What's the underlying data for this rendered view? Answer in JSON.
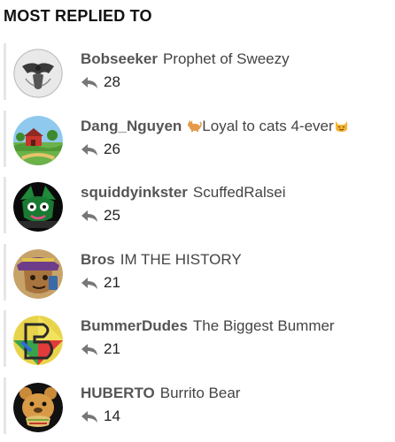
{
  "section": {
    "title": "MOST REPLIED TO"
  },
  "users": [
    {
      "username": "Bobseeker",
      "title": "Prophet of Sweezy",
      "replies": "28"
    },
    {
      "username": "Dang_Nguyen",
      "title": "Loyal to cats 4-ever",
      "title_prefix_icon": "cat-emoji-icon",
      "title_suffix_icon": "smiling-cat-emoji-icon",
      "replies": "26"
    },
    {
      "username": "squiddyinkster",
      "title": "ScuffedRalsei",
      "replies": "25"
    },
    {
      "username": "Bros",
      "title": "IM THE HISTORY",
      "replies": "21"
    },
    {
      "username": "BummerDudes",
      "title": "The Biggest Bummer",
      "replies": "21"
    },
    {
      "username": "HUBERTO",
      "title": "Burrito Bear",
      "replies": "14"
    }
  ],
  "icons": {
    "reply": "reply-arrow-icon"
  },
  "colors": {
    "username": "#555555",
    "rail": "#e6e6e6",
    "reply_icon": "#777777"
  }
}
